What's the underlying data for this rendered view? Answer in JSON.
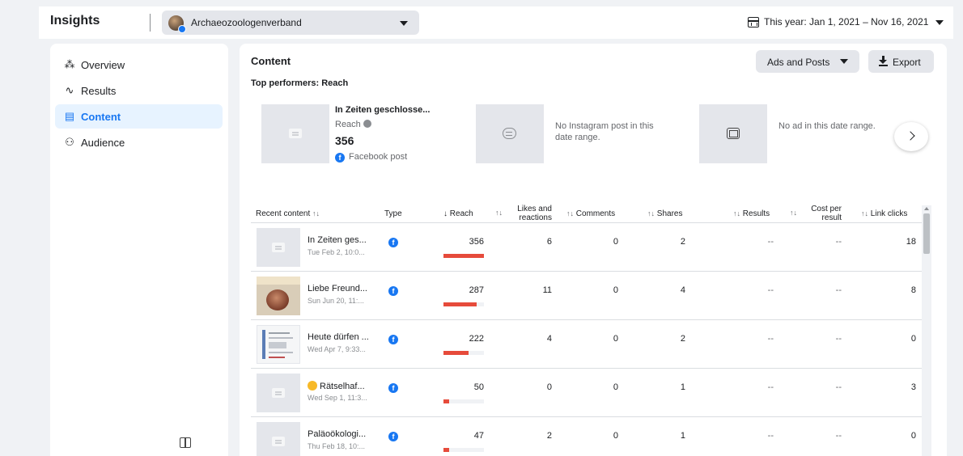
{
  "header": {
    "app_title": "Insights",
    "page_name": "Archaeozoologenverband",
    "date_range": "This year: Jan 1, 2021 – Nov 16, 2021"
  },
  "sidebar": {
    "items": [
      {
        "label": "Overview",
        "icon": "overview-icon",
        "active": false
      },
      {
        "label": "Results",
        "icon": "results-icon",
        "active": false
      },
      {
        "label": "Content",
        "icon": "content-icon",
        "active": true
      },
      {
        "label": "Audience",
        "icon": "audience-icon",
        "active": false
      }
    ]
  },
  "content": {
    "title": "Content",
    "ads_filter": "Ads and Posts",
    "export_label": "Export",
    "top_performers_label": "Top performers: Reach",
    "top_post": {
      "title": "In Zeiten geschlosse...",
      "metric_label": "Reach",
      "value": "356",
      "type_label": "Facebook post"
    },
    "instagram_empty": "No Instagram post in this date range.",
    "ad_empty": "No ad in this date range."
  },
  "table": {
    "headers": {
      "recent_content": "Recent content",
      "type": "Type",
      "reach": "Reach",
      "likes": "Likes and reactions",
      "comments": "Comments",
      "shares": "Shares",
      "results": "Results",
      "cost": "Cost per result",
      "link_clicks": "Link clicks"
    },
    "rows": [
      {
        "title": "In Zeiten ges...",
        "date": "Tue Feb 2, 10:0...",
        "reach": "356",
        "reach_fraction": 1.0,
        "likes": "6",
        "comments": "0",
        "shares": "2",
        "results": "--",
        "cost": "--",
        "link_clicks": "18",
        "thumb": "placeholder"
      },
      {
        "title": "Liebe Freund...",
        "date": "Sun Jun 20, 11:...",
        "reach": "287",
        "reach_fraction": 0.81,
        "likes": "11",
        "comments": "0",
        "shares": "4",
        "results": "--",
        "cost": "--",
        "link_clicks": "8",
        "thumb": "photo"
      },
      {
        "title": "Heute dürfen ...",
        "date": "Wed Apr 7, 9:33...",
        "reach": "222",
        "reach_fraction": 0.62,
        "likes": "4",
        "comments": "0",
        "shares": "2",
        "results": "--",
        "cost": "--",
        "link_clicks": "0",
        "thumb": "document"
      },
      {
        "title": "Rätselhaf...",
        "date": "Wed Sep 1, 11:3...",
        "reach": "50",
        "reach_fraction": 0.14,
        "likes": "0",
        "comments": "0",
        "shares": "1",
        "results": "--",
        "cost": "--",
        "link_clicks": "3",
        "thumb": "placeholder",
        "emoji": true
      },
      {
        "title": "Paläoökologi...",
        "date": "Thu Feb 18, 10:...",
        "reach": "47",
        "reach_fraction": 0.13,
        "likes": "2",
        "comments": "0",
        "shares": "1",
        "results": "--",
        "cost": "--",
        "link_clicks": "0",
        "thumb": "placeholder"
      }
    ]
  },
  "colors": {
    "accent": "#1877f2",
    "reach_bar": "#e64b3b",
    "active_nav_bg": "#e7f3ff"
  }
}
